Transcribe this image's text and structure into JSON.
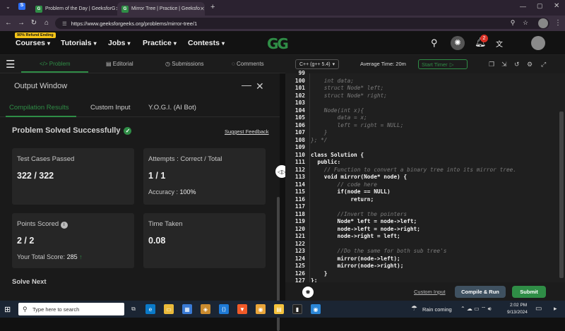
{
  "browser": {
    "tabs": [
      {
        "title": "Problem of the Day | GeeksforG",
        "favicon": "G"
      },
      {
        "title": "Mirror Tree | Practice | Geeksfo",
        "favicon": "G"
      }
    ],
    "url": "https://www.geeksforgeeks.org/problems/mirror-tree/1"
  },
  "gfg_nav": {
    "refund_badge": "90% Refund Ending",
    "items": [
      "Courses",
      "Tutorials",
      "Jobs",
      "Practice",
      "Contests"
    ],
    "logo": "GG",
    "notif_count": "2"
  },
  "left_tabs": {
    "problem": "</> Problem",
    "editorial": "Editorial",
    "submissions": "Submissions",
    "comments": "Comments"
  },
  "output": {
    "title": "Output Window",
    "tabs": [
      "Compilation Results",
      "Custom Input",
      "Y.O.G.I. (AI Bot)"
    ],
    "status": "Problem Solved Successfully",
    "suggest": "Suggest Feedback",
    "test_label": "Test Cases Passed",
    "test_value": "322 / 322",
    "attempts_label": "Attempts : Correct / Total",
    "attempts_value": "1 / 1",
    "accuracy_label": "Accuracy :",
    "accuracy_value": "100%",
    "points_label": "Points Scored",
    "points_value": "2 / 2",
    "total_label": "Your Total Score:",
    "total_value": "285",
    "time_label": "Time Taken",
    "time_value": "0.08",
    "solve_next": "Solve Next"
  },
  "editor": {
    "language": "C++ (g++ 5.4)",
    "avg_time": "Average Time: 20m",
    "timer": "Start Timer",
    "lines": [
      {
        "n": "99",
        "t": "",
        "c": "cm"
      },
      {
        "n": "100",
        "t": "    int data;",
        "c": "cm"
      },
      {
        "n": "101",
        "t": "    struct Node* left;",
        "c": "cm"
      },
      {
        "n": "102",
        "t": "    struct Node* right;",
        "c": "cm"
      },
      {
        "n": "103",
        "t": "",
        "c": "cm"
      },
      {
        "n": "104",
        "t": "    Node(int x){",
        "c": "cm"
      },
      {
        "n": "105",
        "t": "        data = x;",
        "c": "cm"
      },
      {
        "n": "106",
        "t": "        left = right = NULL;",
        "c": "cm"
      },
      {
        "n": "107",
        "t": "    }",
        "c": "cm"
      },
      {
        "n": "108",
        "t": "}; */",
        "c": "cm"
      },
      {
        "n": "109",
        "t": "",
        "c": ""
      },
      {
        "n": "110",
        "t": "class Solution {",
        "c": "kw"
      },
      {
        "n": "111",
        "t": "  public:",
        "c": "kw"
      },
      {
        "n": "112",
        "t": "    // Function to convert a binary tree into its mirror tree.",
        "c": "cm"
      },
      {
        "n": "113",
        "t": "    void mirror(Node* node) {",
        "c": "kw"
      },
      {
        "n": "114",
        "t": "        // code here",
        "c": "cm"
      },
      {
        "n": "115",
        "t": "        if(node == NULL)",
        "c": "kw"
      },
      {
        "n": "116",
        "t": "            return;",
        "c": "kw"
      },
      {
        "n": "117",
        "t": "",
        "c": ""
      },
      {
        "n": "118",
        "t": "        //Invert the pointers",
        "c": "cm"
      },
      {
        "n": "119",
        "t": "        Node* left = node->left;",
        "c": "kw"
      },
      {
        "n": "120",
        "t": "        node->left = node->right;",
        "c": "kw"
      },
      {
        "n": "121",
        "t": "        node->right = left;",
        "c": "kw"
      },
      {
        "n": "122",
        "t": "",
        "c": ""
      },
      {
        "n": "123",
        "t": "        //Do the same for both sub tree's",
        "c": "cm"
      },
      {
        "n": "124",
        "t": "        mirror(node->left);",
        "c": "kw"
      },
      {
        "n": "125",
        "t": "        mirror(node->right);",
        "c": "kw"
      },
      {
        "n": "126",
        "t": "    }",
        "c": "kw"
      },
      {
        "n": "127",
        "t": "};",
        "c": "kw"
      }
    ],
    "custom_input": "Custom Input",
    "compile": "Compile & Run",
    "submit": "Submit"
  },
  "taskbar": {
    "search": "Type here to search",
    "weather": "Rain coming",
    "time": "2:02 PM",
    "date": "9/13/2024"
  },
  "colors": {
    "accent": "#2f8d46"
  }
}
